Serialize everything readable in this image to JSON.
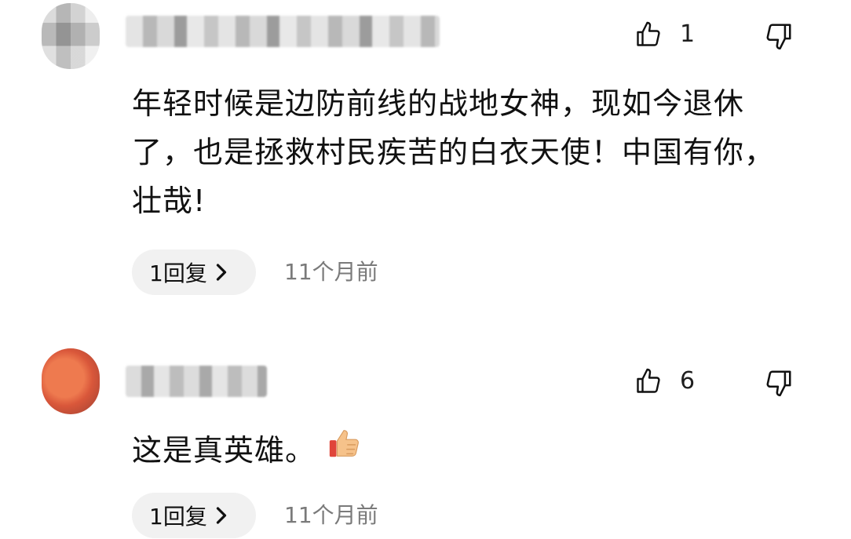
{
  "comments": [
    {
      "like_count": "1",
      "text": "年轻时候是边防前线的战地女神，现如今退休了，也是拯救村民疾苦的白衣天使！中国有你，壮哉!",
      "reply_label": "1回复",
      "time": "11个月前",
      "icons": {
        "like": "thumbs-up-outline-icon",
        "dislike": "thumbs-down-outline-icon",
        "chevron": "chevron-right-icon"
      }
    },
    {
      "like_count": "6",
      "text": "这是真英雄。",
      "emoji": "thumbs-up-emoji",
      "reply_label": "1回复",
      "time": "11个月前",
      "icons": {
        "like": "thumbs-up-outline-icon",
        "dislike": "thumbs-down-outline-icon",
        "chevron": "chevron-right-icon"
      }
    }
  ],
  "colors": {
    "timestamp": "#7a7a7a",
    "pill_bg": "#f1f1f1",
    "avatar2": "#e06a45"
  }
}
